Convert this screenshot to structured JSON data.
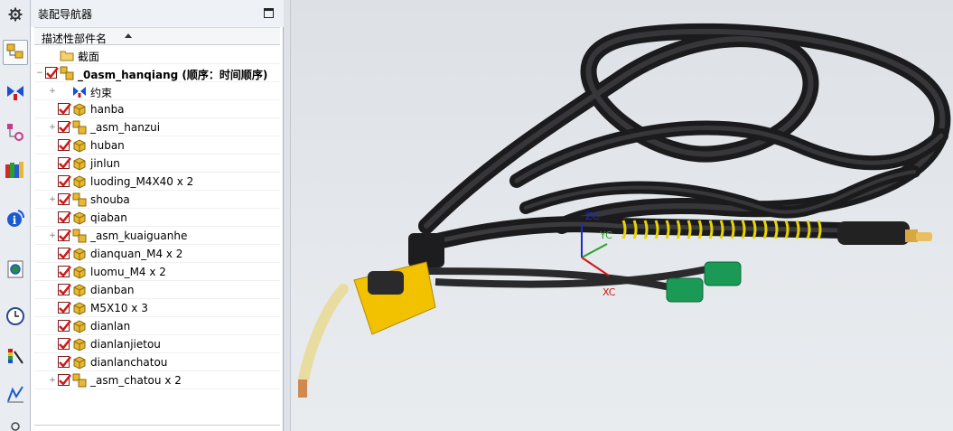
{
  "navigator": {
    "title": "装配导航器",
    "column_header": "描述性部件名",
    "rows": [
      {
        "label": "截面",
        "type": "folder",
        "level": 0,
        "checked": false,
        "expander": ""
      },
      {
        "label": "_0asm_hanqiang (顺序：时间顺序)",
        "type": "assembly",
        "level": 0,
        "checked": true,
        "expander": "−",
        "bold": true
      },
      {
        "label": "约束",
        "type": "constraint",
        "level": 1,
        "checked": false,
        "expander": "+"
      },
      {
        "label": "hanba",
        "type": "part",
        "level": 1,
        "checked": true,
        "expander": ""
      },
      {
        "label": "_asm_hanzui",
        "type": "assembly",
        "level": 1,
        "checked": true,
        "expander": "+"
      },
      {
        "label": "huban",
        "type": "part",
        "level": 1,
        "checked": true,
        "expander": ""
      },
      {
        "label": "jinlun",
        "type": "part",
        "level": 1,
        "checked": true,
        "expander": ""
      },
      {
        "label": "luoding_M4X40 x 2",
        "type": "part",
        "level": 1,
        "checked": true,
        "expander": ""
      },
      {
        "label": "shouba",
        "type": "assembly",
        "level": 1,
        "checked": true,
        "expander": "+"
      },
      {
        "label": "qiaban",
        "type": "part",
        "level": 1,
        "checked": true,
        "expander": ""
      },
      {
        "label": "_asm_kuaiguanhe",
        "type": "assembly",
        "level": 1,
        "checked": true,
        "expander": "+"
      },
      {
        "label": "dianquan_M4 x 2",
        "type": "part",
        "level": 1,
        "checked": true,
        "expander": ""
      },
      {
        "label": "luomu_M4 x 2",
        "type": "part",
        "level": 1,
        "checked": true,
        "expander": ""
      },
      {
        "label": "dianban",
        "type": "part",
        "level": 1,
        "checked": true,
        "expander": ""
      },
      {
        "label": "M5X10 x 3",
        "type": "part",
        "level": 1,
        "checked": true,
        "expander": ""
      },
      {
        "label": "dianlan",
        "type": "part",
        "level": 1,
        "checked": true,
        "expander": ""
      },
      {
        "label": "dianlanjietou",
        "type": "part",
        "level": 1,
        "checked": true,
        "expander": ""
      },
      {
        "label": "dianlanchatou",
        "type": "part",
        "level": 1,
        "checked": true,
        "expander": ""
      },
      {
        "label": "_asm_chatou x 2",
        "type": "assembly",
        "level": 1,
        "checked": true,
        "expander": "+"
      }
    ]
  },
  "resource_bar": {
    "items": [
      {
        "name": "settings-gear-icon"
      },
      {
        "name": "assembly-navigator-icon",
        "active": true
      },
      {
        "name": "constraint-navigator-icon"
      },
      {
        "name": "part-navigator-icon"
      },
      {
        "name": "reuse-library-icon"
      },
      {
        "name": "hd3d-tools-icon"
      },
      {
        "name": "web-browser-icon"
      },
      {
        "name": "history-clock-icon"
      },
      {
        "name": "visualization-palette-icon"
      },
      {
        "name": "process-studio-icon"
      },
      {
        "name": "roles-icon"
      }
    ]
  },
  "viewport": {
    "axes": {
      "zc": "ZC",
      "yc": "YC",
      "xc": "XC"
    }
  },
  "colors": {
    "checkbox_red": "#d01818",
    "part_yellow": "#e8b830",
    "cable": "#2b2b2d",
    "torch_yellow": "#f2c200",
    "connector_green": "#1a9a55"
  }
}
